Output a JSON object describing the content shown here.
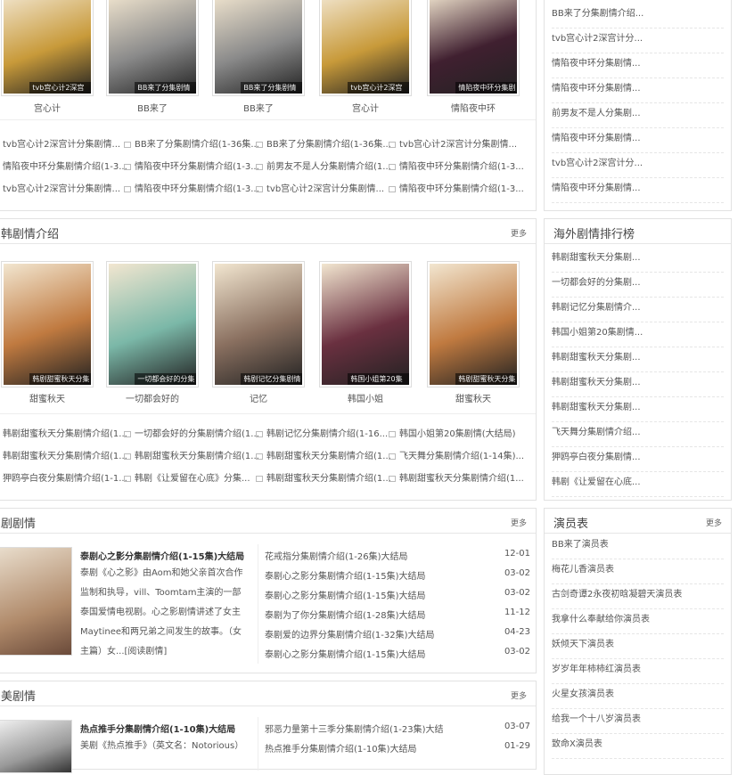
{
  "colors": {
    "border": "#e2e2e2",
    "text": "#555555"
  },
  "top": {
    "posters": [
      {
        "name": "宫心计",
        "cap": "tvb宫心计2深宫",
        "bg": "#c89a3a"
      },
      {
        "name": "BB来了",
        "cap": "BB来了分集剧情",
        "bg": "#8a8a8a"
      },
      {
        "name": "BB来了",
        "cap": "BB来了分集剧情",
        "bg": "#8a8a8a"
      },
      {
        "name": "宫心计",
        "cap": "tvb宫心计2深宫",
        "bg": "#c89a3a"
      },
      {
        "name": "情陷夜中环",
        "cap": "情陷夜中环分集剧",
        "bg": "#402030"
      }
    ],
    "links": [
      [
        "tvb宫心计2深宫计分集剧情...",
        "BB来了分集剧情介绍(1-36集...",
        "BB来了分集剧情介绍(1-36集...",
        "tvb宫心计2深宫计分集剧情..."
      ],
      [
        "情陷夜中环分集剧情介绍(1-3...",
        "情陷夜中环分集剧情介绍(1-3...",
        "前男友不是人分集剧情介绍(1...",
        "情陷夜中环分集剧情介绍(1-3..."
      ],
      [
        "tvb宫心计2深宫计分集剧情...",
        "情陷夜中环分集剧情介绍(1-3...",
        "tvb宫心计2深宫计分集剧情...",
        "情陷夜中环分集剧情介绍(1-3..."
      ]
    ]
  },
  "korean": {
    "title": "韩剧情介绍",
    "more": "更多",
    "posters": [
      {
        "name": "甜蜜秋天",
        "cap": "韩剧甜蜜秋天分集",
        "bg": "#c07a40"
      },
      {
        "name": "一切都会好的",
        "cap": "一切都会好的分集",
        "bg": "#7bb8a8"
      },
      {
        "name": "记忆",
        "cap": "韩剧记忆分集剧情",
        "bg": "#8a7060"
      },
      {
        "name": "韩国小姐",
        "cap": "韩国小姐第20集",
        "bg": "#6a3040"
      },
      {
        "name": "甜蜜秋天",
        "cap": "韩剧甜蜜秋天分集",
        "bg": "#c07a40"
      }
    ],
    "links": [
      [
        "韩剧甜蜜秋天分集剧情介绍(1...",
        "一切都会好的分集剧情介绍(1...",
        "韩剧记忆分集剧情介绍(1-16...",
        "韩国小姐第20集剧情(大结局)"
      ],
      [
        "韩剧甜蜜秋天分集剧情介绍(1...",
        "韩剧甜蜜秋天分集剧情介绍(1...",
        "韩剧甜蜜秋天分集剧情介绍(1...",
        "飞天舞分集剧情介绍(1-14集)..."
      ],
      [
        "狎鸥亭白夜分集剧情介绍(1-1...",
        "韩剧《让爱留在心底》分集...",
        "韩剧甜蜜秋天分集剧情介绍(1...",
        "韩剧甜蜜秋天分集剧情介绍(1..."
      ]
    ]
  },
  "thai": {
    "title": "剧剧情",
    "more": "更多",
    "feature_title": "泰剧心之影分集剧情介绍(1-15集)大结局",
    "feature_desc": "泰剧《心之影》由Aom和她父亲首次合作监制和执导，vill、Toomtam主演的一部泰国爱情电视剧。心之影剧情讲述了女主Maytinee和两兄弟之间发生的故事。（女主篇）女...[阅读剧情]",
    "rows": [
      {
        "t": "花戒指分集剧情介绍(1-26集)大结局",
        "d": "12-01"
      },
      {
        "t": "泰剧心之影分集剧情介绍(1-15集)大结局",
        "d": "03-02"
      },
      {
        "t": "泰剧心之影分集剧情介绍(1-15集)大结局",
        "d": "03-02"
      },
      {
        "t": "泰剧为了你分集剧情介绍(1-28集)大结局",
        "d": "11-12"
      },
      {
        "t": "泰剧爱的边界分集剧情介绍(1-32集)大结局",
        "d": "04-23"
      },
      {
        "t": "泰剧心之影分集剧情介绍(1-15集)大结局",
        "d": "03-02"
      }
    ]
  },
  "us": {
    "title": "美剧情",
    "more": "更多",
    "feature_title": "热点推手分集剧情介绍(1-10集)大结局",
    "feature_desc": "美剧《热点推手》（英文名：Notorious）",
    "rows": [
      {
        "t": "邪恶力量第十三季分集剧情介绍(1-23集)大结",
        "d": "03-07"
      },
      {
        "t": "热点推手分集剧情介绍(1-10集)大结局",
        "d": "01-29"
      }
    ]
  },
  "side1": {
    "items": [
      "BB来了分集剧情介绍...",
      "tvb宫心计2深宫计分...",
      "情陷夜中环分集剧情...",
      "情陷夜中环分集剧情...",
      "前男友不是人分集剧...",
      "情陷夜中环分集剧情...",
      "tvb宫心计2深宫计分...",
      "情陷夜中环分集剧情..."
    ]
  },
  "side2": {
    "title": "海外剧情排行榜",
    "items": [
      "韩剧甜蜜秋天分集剧...",
      "一切都会好的分集剧...",
      "韩剧记忆分集剧情介...",
      "韩国小姐第20集剧情...",
      "韩剧甜蜜秋天分集剧...",
      "韩剧甜蜜秋天分集剧...",
      "韩剧甜蜜秋天分集剧...",
      "飞天舞分集剧情介绍...",
      "狎鸥亭白夜分集剧情...",
      "韩剧《让爱留在心底..."
    ]
  },
  "side3": {
    "title": "演员表",
    "more": "更多",
    "items": [
      "BB来了演员表",
      "梅花儿香演员表",
      "古剑奇谭2永夜初晗凝碧天演员表",
      "我拿什么奉献给你演员表",
      "妖倾天下演员表",
      "岁岁年年柿柿红演员表",
      "火星女孩演员表",
      "给我一个十八岁演员表",
      "致命X演员表"
    ]
  }
}
